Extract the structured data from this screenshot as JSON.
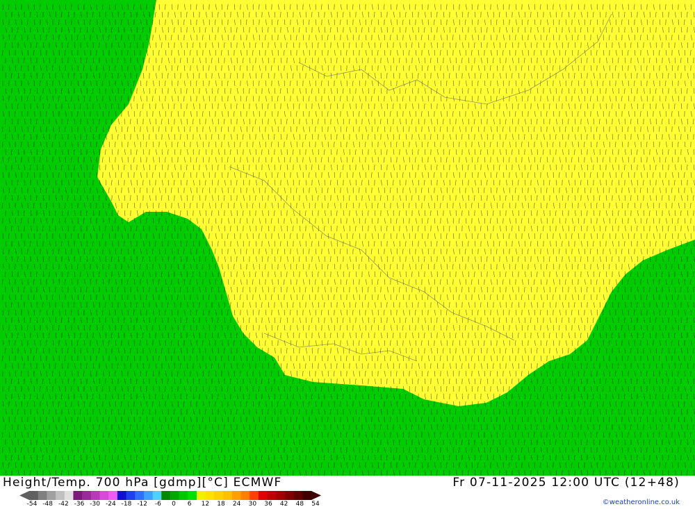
{
  "map": {
    "title": "Height/Temp. 700 hPa [gdmp][°C] ECMWF",
    "valid_time": "Fr 07-11-2025 12:00 UTC (12+48)",
    "credit": "©weatheronline.co.uk",
    "legend": {
      "ticks": [
        "-54",
        "-48",
        "-42",
        "-36",
        "-30",
        "-24",
        "-18",
        "-12",
        "-6",
        "0",
        "6",
        "12",
        "18",
        "24",
        "30",
        "36",
        "42",
        "48",
        "54"
      ],
      "colors": [
        "#606060",
        "#808080",
        "#a0a0a0",
        "#c0c0c0",
        "#e0e0e0",
        "#7a1a7a",
        "#9a2a9a",
        "#b83ab8",
        "#d84ad8",
        "#f05af0",
        "#1010d0",
        "#2040f0",
        "#3070ff",
        "#40a0ff",
        "#50d0ff",
        "#008800",
        "#00a800",
        "#00c800",
        "#00e000",
        "#f0f000",
        "#ffe000",
        "#ffd000",
        "#ffc000",
        "#ffa000",
        "#ff8000",
        "#ff4000",
        "#e00000",
        "#c00000",
        "#a00000",
        "#800000",
        "#600000",
        "#400000"
      ]
    },
    "colors": {
      "warm_area": "#ffff33",
      "cool_area": "#00cc00",
      "glyph": "#000000"
    }
  }
}
